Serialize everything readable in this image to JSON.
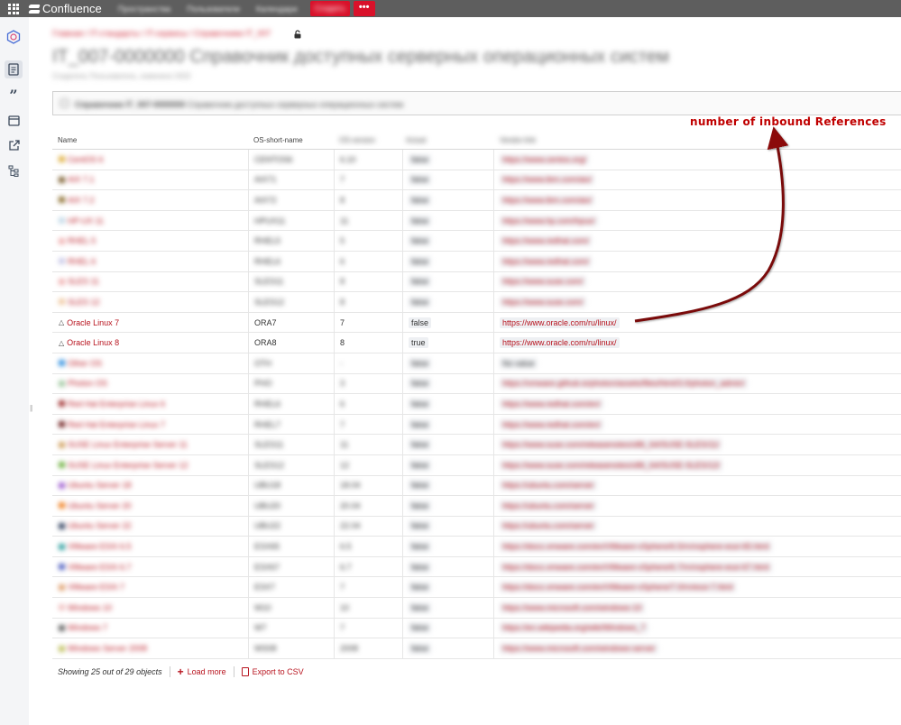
{
  "app": {
    "name": "Confluence",
    "nav": [
      "Пространства",
      "Пользователи",
      "Календари"
    ],
    "create_label": "Создать",
    "more_label": "•••"
  },
  "page": {
    "breadcrumb": "Главная / IT-стандарты / IT-сервисы / Справочники IT_007",
    "title": "IT_007-0000000 Справочник доступных серверных операционных систем",
    "byline": "Создатель Пользователь, изменено 2022",
    "macro_title": "Справочник IT_007-0000000",
    "macro_text": "Справочник доступных серверных операционных систем"
  },
  "annotation": {
    "text": "number of inbound References"
  },
  "table": {
    "columns": [
      "Name",
      "OS-short-name",
      "OS-version",
      "Actual",
      "Vendor-link"
    ],
    "rows": [
      {
        "name": "CentOS 6",
        "short": "CENTOS6",
        "version": "6.10",
        "flag": "false",
        "url": "https://www.centos.org/",
        "icon_color": "#e0b040",
        "visible": false
      },
      {
        "name": "AIX 7.1",
        "short": "AIX71",
        "version": "7",
        "flag": "false",
        "url": "https://www.ibm.com/aix/",
        "icon_color": "#7a5b2a",
        "visible": false
      },
      {
        "name": "AIX 7.2",
        "short": "AIX72",
        "version": "8",
        "flag": "false",
        "url": "https://www.ibm.com/aix/",
        "icon_color": "#8a6b2a",
        "visible": false
      },
      {
        "name": "HP-UX 11",
        "short": "HPUX11",
        "version": "11",
        "flag": "false",
        "url": "https://www.hp.com/hpux/",
        "icon_color": "#c0d8e8",
        "visible": false
      },
      {
        "name": "RHEL 5",
        "short": "RHEL5",
        "version": "5",
        "flag": "false",
        "url": "https://www.redhat.com/",
        "icon_color": "#f0b0b0",
        "visible": false
      },
      {
        "name": "RHEL 6",
        "short": "RHEL6",
        "version": "6",
        "flag": "false",
        "url": "https://www.redhat.com/",
        "icon_color": "#c8c8e8",
        "visible": false
      },
      {
        "name": "SLES 11",
        "short": "SLES11",
        "version": "8",
        "flag": "false",
        "url": "https://www.suse.com/",
        "icon_color": "#f0b0b0",
        "visible": false
      },
      {
        "name": "SLES 12",
        "short": "SLES12",
        "version": "8",
        "flag": "false",
        "url": "https://www.suse.com/",
        "icon_color": "#f0c8a0",
        "visible": false
      },
      {
        "name": "Oracle Linux 7",
        "short": "ORA7",
        "version": "7",
        "flag": "false",
        "url": "https://www.oracle.com/ru/linux/",
        "icon_color": "#444444",
        "visible": true
      },
      {
        "name": "Oracle Linux 8",
        "short": "ORA8",
        "version": "8",
        "flag": "true",
        "url": "https://www.oracle.com/ru/linux/",
        "icon_color": "#444444",
        "visible": true
      },
      {
        "name": "Other OS",
        "short": "OTH",
        "version": "-",
        "flag": "false",
        "url": "No value",
        "icon_color": "#3090e0",
        "visible": false
      },
      {
        "name": "Photon OS",
        "short": "PHO",
        "version": "3",
        "flag": "false",
        "url": "https://vmware.github.io/photon/assets/files/html/3.0/photon_admin/",
        "icon_color": "#a0c8a0",
        "visible": false
      },
      {
        "name": "Red Hat Enterprise Linux 6",
        "short": "RHEL6",
        "version": "6",
        "flag": "false",
        "url": "https://www.redhat.com/en/",
        "icon_color": "#a03030",
        "visible": false
      },
      {
        "name": "Red Hat Enterprise Linux 7",
        "short": "RHEL7",
        "version": "7",
        "flag": "false",
        "url": "https://www.redhat.com/en/",
        "icon_color": "#702020",
        "visible": false
      },
      {
        "name": "SUSE Linux Enterprise Server 11",
        "short": "SLES11",
        "version": "11",
        "flag": "false",
        "url": "https://www.suse.com/releasenotes/x86_64/SUSE-SLES/11/",
        "icon_color": "#d0a060",
        "visible": false
      },
      {
        "name": "SUSE Linux Enterprise Server 12",
        "short": "SLES12",
        "version": "12",
        "flag": "false",
        "url": "https://www.suse.com/releasenotes/x86_64/SUSE-SLES/12/",
        "icon_color": "#70b040",
        "visible": false
      },
      {
        "name": "Ubuntu Server 18",
        "short": "UBU18",
        "version": "18.04",
        "flag": "false",
        "url": "https://ubuntu.com/server",
        "icon_color": "#a060d0",
        "visible": false
      },
      {
        "name": "Ubuntu Server 20",
        "short": "UBU20",
        "version": "20.04",
        "flag": "false",
        "url": "https://ubuntu.com/server",
        "icon_color": "#f08020",
        "visible": false
      },
      {
        "name": "Ubuntu Server 22",
        "short": "UBU22",
        "version": "22.04",
        "flag": "false",
        "url": "https://ubuntu.com/server",
        "icon_color": "#304060",
        "visible": false
      },
      {
        "name": "VMware ESXi 6.5",
        "short": "ESX65",
        "version": "6.5",
        "flag": "false",
        "url": "https://docs.vmware.com/en/VMware-vSphere/6.5/rn/vsphere-esxi-65.html",
        "icon_color": "#30a0a0",
        "visible": false
      },
      {
        "name": "VMware ESXi 6.7",
        "short": "ESX67",
        "version": "6.7",
        "flag": "false",
        "url": "https://docs.vmware.com/en/VMware-vSphere/6.7/rn/vsphere-esxi-67.html",
        "icon_color": "#5060c0",
        "visible": false
      },
      {
        "name": "VMware ESXi 7",
        "short": "ESX7",
        "version": "7",
        "flag": "false",
        "url": "https://docs.vmware.com/en/VMware-vSphere/7.0/rn/esxi-7.html",
        "icon_color": "#e0a070",
        "visible": false
      },
      {
        "name": "Windows 10",
        "short": "W10",
        "version": "10",
        "flag": "false",
        "url": "https://www.microsoft.com/windows-10",
        "icon_color": "#f0c0c0",
        "visible": false
      },
      {
        "name": "Windows 7",
        "short": "W7",
        "version": "7",
        "flag": "false",
        "url": "https://en.wikipedia.org/wiki/Windows_7",
        "icon_color": "#606060",
        "visible": false
      },
      {
        "name": "Windows Server 2008",
        "short": "WS08",
        "version": "2008",
        "flag": "false",
        "url": "https://www.microsoft.com/windows-server",
        "icon_color": "#c0c060",
        "visible": false
      }
    ]
  },
  "footer": {
    "showing": "Showing 25 out of 29 objects",
    "load_more": "Load more",
    "export_csv": "Export to CSV"
  }
}
